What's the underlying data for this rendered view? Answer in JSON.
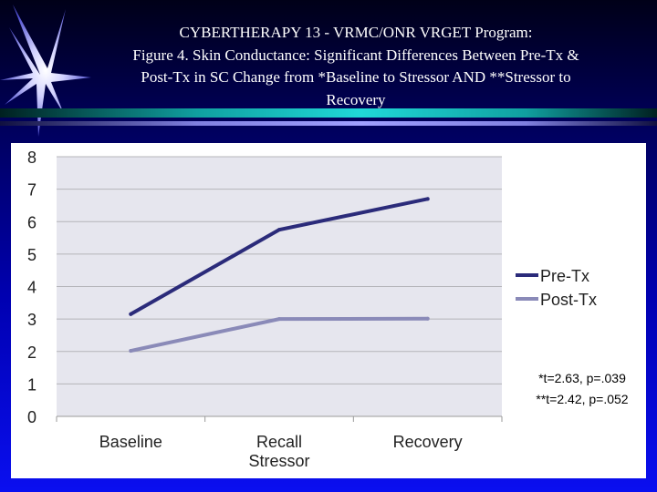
{
  "slide": {
    "title_line1": "CYBERTHERAPY 13 - VRMC/ONR VRGET Program:",
    "title_line2": "Figure 4.  Skin Conductance:  Significant Differences Between Pre-Tx &",
    "title_line3": "Post-Tx in SC Change from *Baseline to Stressor AND **Stressor to",
    "title_line4": "Recovery",
    "note_line1": "*t=2.63, p=.039",
    "note_line2": "**t=2.42, p=.052"
  },
  "chart_data": {
    "type": "line",
    "categories": [
      "Baseline",
      "Recall Stressor",
      "Recovery"
    ],
    "category_lines": [
      [
        "Baseline"
      ],
      [
        "Recall",
        "Stressor"
      ],
      [
        "Recovery"
      ]
    ],
    "ylim": [
      0,
      8
    ],
    "yticks": [
      0,
      1,
      2,
      3,
      4,
      5,
      6,
      7,
      8
    ],
    "grid": true,
    "legend_position": "right",
    "plot_background": "#e6e6ee",
    "series": [
      {
        "name": "Pre-Tx",
        "values": [
          3.15,
          5.75,
          6.7
        ],
        "color": "#2b2b7a"
      },
      {
        "name": "Post-Tx",
        "values": [
          2.02,
          3.0,
          3.01
        ],
        "color": "#8a8ab8"
      }
    ]
  }
}
